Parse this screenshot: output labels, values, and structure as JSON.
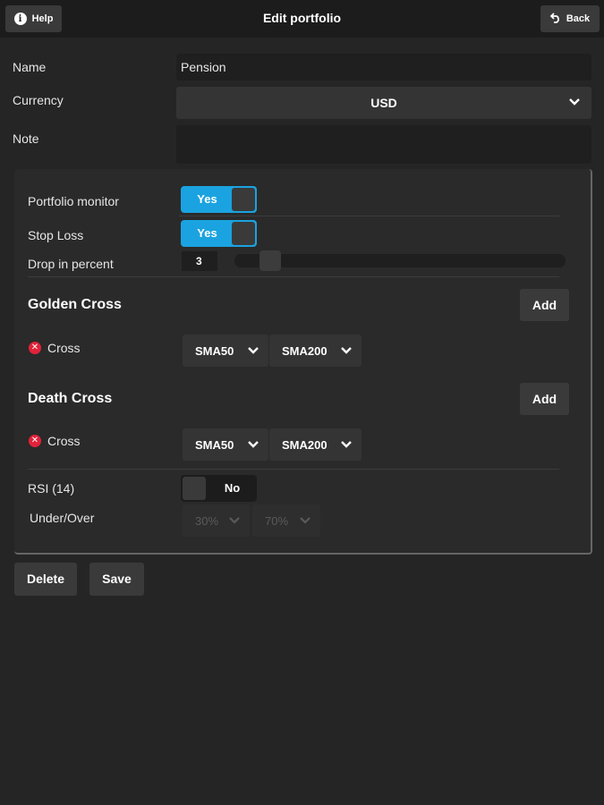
{
  "header": {
    "help_label": "Help",
    "title": "Edit portfolio",
    "back_label": "Back"
  },
  "form": {
    "name_label": "Name",
    "name_value": "Pension",
    "currency_label": "Currency",
    "currency_value": "USD",
    "note_label": "Note",
    "note_value": ""
  },
  "monitor": {
    "portfolio_monitor_label": "Portfolio monitor",
    "portfolio_monitor_value": "Yes",
    "stop_loss_label": "Stop Loss",
    "stop_loss_value": "Yes",
    "drop_label": "Drop in percent",
    "drop_value": "3"
  },
  "golden_cross": {
    "title": "Golden Cross",
    "add_label": "Add",
    "row_label": "Cross",
    "select_1": "SMA50",
    "select_2": "SMA200"
  },
  "death_cross": {
    "title": "Death Cross",
    "add_label": "Add",
    "row_label": "Cross",
    "select_1": "SMA50",
    "select_2": "SMA200"
  },
  "rsi": {
    "label": "RSI (14)",
    "value": "No",
    "under_over_label": "Under/Over",
    "under_value": "30%",
    "over_value": "70%"
  },
  "actions": {
    "delete_label": "Delete",
    "save_label": "Save"
  },
  "colors": {
    "toggle_on": "#1aa3e0",
    "remove_icon": "#e0223a",
    "background": "#252525"
  }
}
